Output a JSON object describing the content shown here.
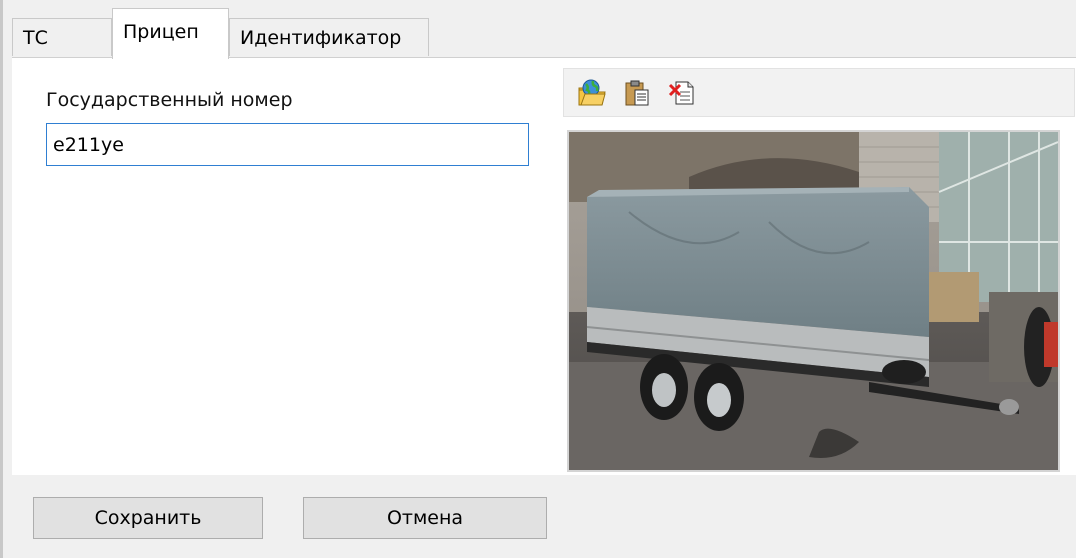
{
  "tabs": [
    {
      "label": "ТС",
      "active": false
    },
    {
      "label": "Прицеп",
      "active": true
    },
    {
      "label": "Идентификатор",
      "active": false
    }
  ],
  "form": {
    "plate_label": "Государственный номер",
    "plate_value": "e211ye"
  },
  "toolbar": {
    "icons": [
      "open-image-icon",
      "paste-icon",
      "delete-image-icon"
    ]
  },
  "image": {
    "subject": "trailer-photo"
  },
  "buttons": {
    "save_label": "Сохранить",
    "cancel_label": "Отмена"
  },
  "colors": {
    "input_border": "#2f7fd2",
    "panel_bg": "#ffffff",
    "window_bg": "#f0f0f0"
  }
}
